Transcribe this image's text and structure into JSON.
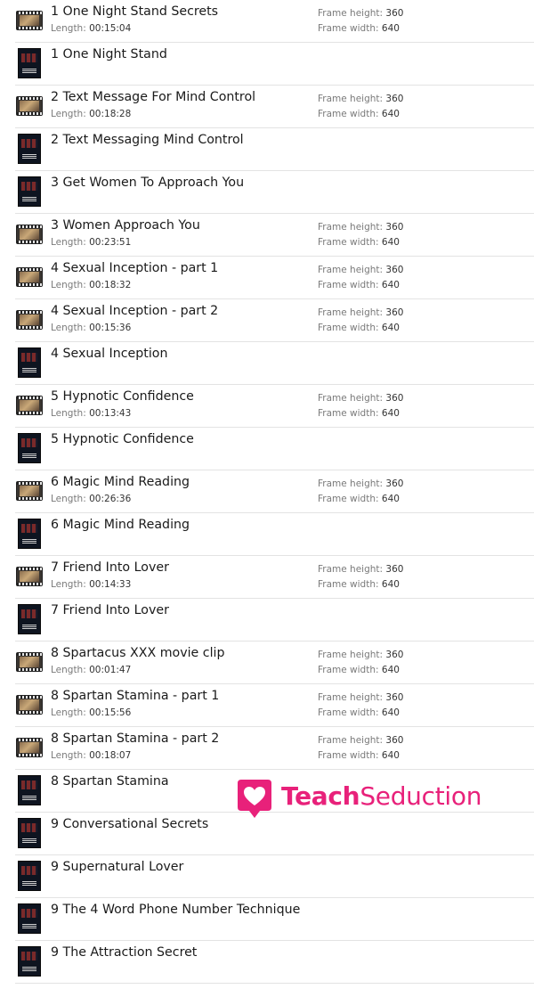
{
  "labels": {
    "length": "Length:",
    "frame_height": "Frame height:",
    "frame_width": "Frame width:"
  },
  "logo": {
    "part1": "Teach",
    "part2": "Seduction",
    "color": "#e8217a"
  },
  "items": [
    {
      "title": "1 One Night Stand Secrets",
      "type": "video",
      "length": "00:15:04",
      "frame_height": "360",
      "frame_width": "640"
    },
    {
      "title": "1 One Night Stand",
      "type": "document"
    },
    {
      "title": "2 Text Message For Mind Control",
      "type": "video",
      "length": "00:18:28",
      "frame_height": "360",
      "frame_width": "640"
    },
    {
      "title": "2 Text Messaging Mind Control",
      "type": "document"
    },
    {
      "title": "3 Get Women To Approach You",
      "type": "document"
    },
    {
      "title": "3 Women Approach You",
      "type": "video",
      "length": "00:23:51",
      "frame_height": "360",
      "frame_width": "640"
    },
    {
      "title": "4 Sexual Inception - part 1",
      "type": "video",
      "length": "00:18:32",
      "frame_height": "360",
      "frame_width": "640"
    },
    {
      "title": "4 Sexual Inception - part 2",
      "type": "video",
      "length": "00:15:36",
      "frame_height": "360",
      "frame_width": "640"
    },
    {
      "title": "4 Sexual Inception",
      "type": "document"
    },
    {
      "title": "5 Hypnotic Confidence",
      "type": "video",
      "length": "00:13:43",
      "frame_height": "360",
      "frame_width": "640"
    },
    {
      "title": "5 Hypnotic Confidence",
      "type": "document"
    },
    {
      "title": "6 Magic Mind Reading",
      "type": "video",
      "length": "00:26:36",
      "frame_height": "360",
      "frame_width": "640"
    },
    {
      "title": "6 Magic Mind Reading",
      "type": "document"
    },
    {
      "title": "7 Friend Into Lover",
      "type": "video",
      "length": "00:14:33",
      "frame_height": "360",
      "frame_width": "640"
    },
    {
      "title": "7 Friend Into Lover",
      "type": "document"
    },
    {
      "title": "8 Spartacus XXX movie clip",
      "type": "video",
      "length": "00:01:47",
      "frame_height": "360",
      "frame_width": "640"
    },
    {
      "title": "8 Spartan Stamina - part 1",
      "type": "video",
      "length": "00:15:56",
      "frame_height": "360",
      "frame_width": "640"
    },
    {
      "title": "8 Spartan Stamina - part 2",
      "type": "video",
      "length": "00:18:07",
      "frame_height": "360",
      "frame_width": "640"
    },
    {
      "title": "8 Spartan Stamina",
      "type": "document"
    },
    {
      "title": "9 Conversational Secrets",
      "type": "document"
    },
    {
      "title": "9 Supernatural Lover",
      "type": "document"
    },
    {
      "title": "9 The 4 Word Phone Number Technique",
      "type": "document"
    },
    {
      "title": "9 The Attraction Secret",
      "type": "document"
    }
  ]
}
